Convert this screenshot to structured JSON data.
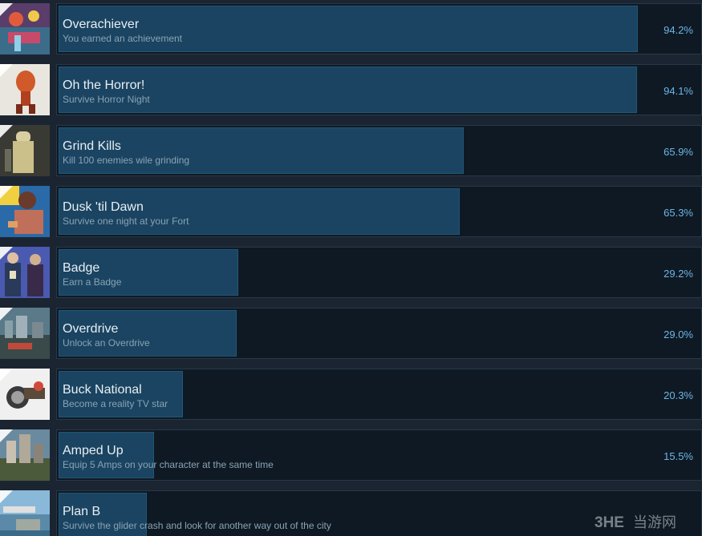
{
  "achievements": [
    {
      "title": "Overachiever",
      "description": "You earned an achievement",
      "percent": "94.2%",
      "fill": 0.942,
      "icon": "overachiever-art-icon"
    },
    {
      "title": "Oh the Horror!",
      "description": "Survive Horror Night",
      "percent": "94.1%",
      "fill": 0.941,
      "icon": "horror-art-icon"
    },
    {
      "title": "Grind Kills",
      "description": "Kill 100 enemies wile grinding",
      "percent": "65.9%",
      "fill": 0.659,
      "icon": "grind-kills-art-icon"
    },
    {
      "title": "Dusk 'til Dawn",
      "description": "Survive one night at your Fort",
      "percent": "65.3%",
      "fill": 0.653,
      "icon": "dusk-til-dawn-art-icon"
    },
    {
      "title": "Badge",
      "description": "Earn a Badge",
      "percent": "29.2%",
      "fill": 0.292,
      "icon": "badge-art-icon"
    },
    {
      "title": "Overdrive",
      "description": "Unlock an Overdrive",
      "percent": "29.0%",
      "fill": 0.29,
      "icon": "overdrive-art-icon"
    },
    {
      "title": "Buck National",
      "description": "Become a reality TV star",
      "percent": "20.3%",
      "fill": 0.203,
      "icon": "buck-national-art-icon"
    },
    {
      "title": "Amped Up",
      "description": "Equip 5 Amps on your character at the same time",
      "percent": "15.5%",
      "fill": 0.155,
      "icon": "amped-up-art-icon"
    },
    {
      "title": "Plan B",
      "description": "Survive the glider crash and look for another way out of the city",
      "percent": "",
      "fill": 0.143,
      "icon": "plan-b-art-icon"
    }
  ],
  "watermark": {
    "text": "当游网",
    "logo": "3HE"
  },
  "colors": {
    "background": "#1b2531",
    "panel": "#0f1923",
    "bar": "#1a4461",
    "title": "#e8eef3",
    "description": "#8aa3b5",
    "percent": "#6bb6e6"
  }
}
